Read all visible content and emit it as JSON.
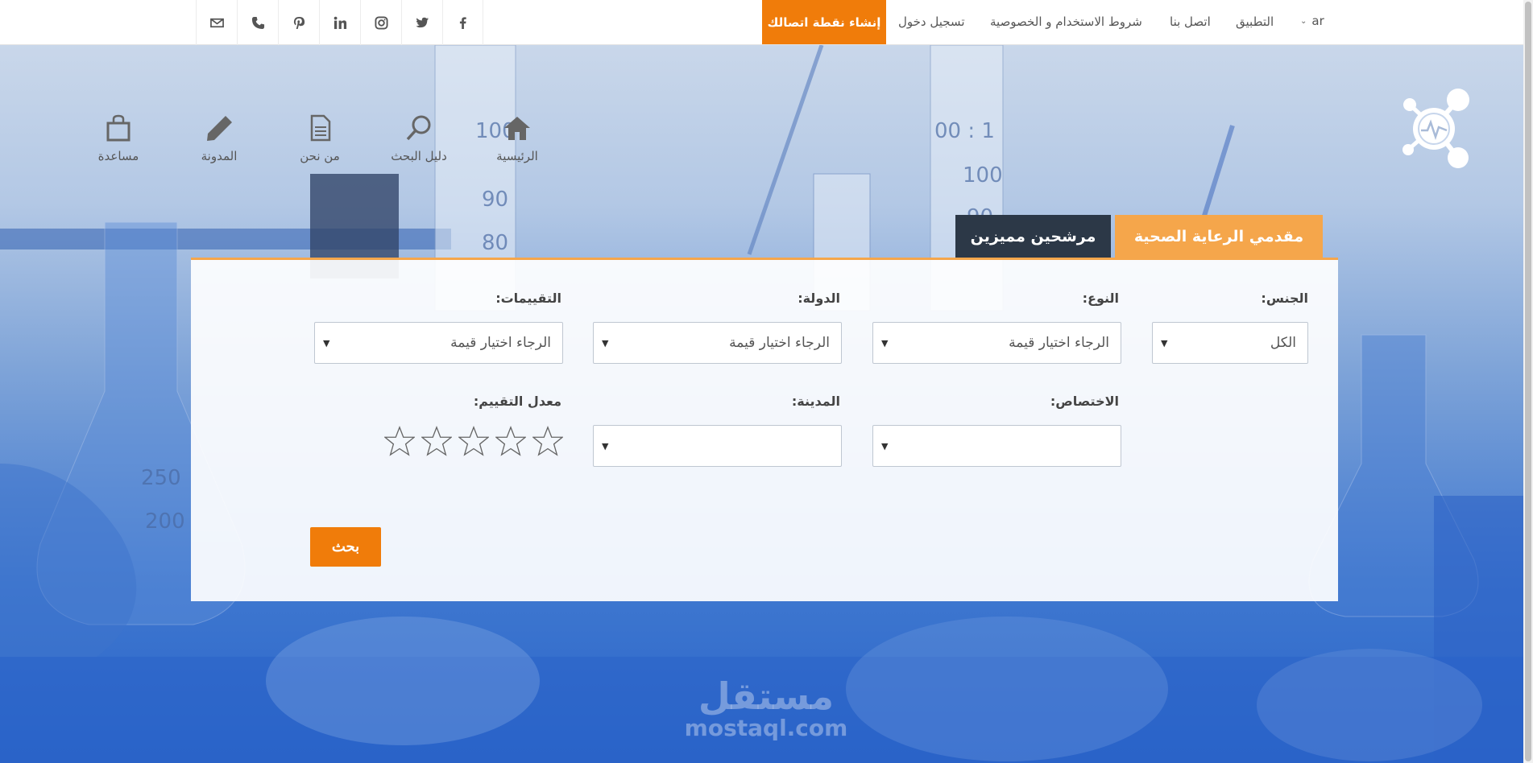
{
  "social_icons": [
    "facebook-icon",
    "twitter-icon",
    "instagram-icon",
    "linkedin-icon",
    "pinterest-icon",
    "phone-icon",
    "mail-icon"
  ],
  "topnav": {
    "cta": "إنشاء نقطة اتصالك",
    "login": "تسجيل دخول",
    "terms": "شروط الاستخدام و الخصوصية",
    "contact": "اتصل بنا",
    "app": "التطبيق",
    "lang": "ar"
  },
  "mainnav": {
    "home": "الرئيسية",
    "search_guide": "دليل البحث",
    "about": "من نحن",
    "blog": "المدونة",
    "help": "مساعدة"
  },
  "tabs": {
    "providers": "مقدمي الرعاية الصحية",
    "featured": "مرشحين مميزين"
  },
  "form": {
    "gender_label": "الجنس:",
    "gender_value": "الكل",
    "type_label": "النوع:",
    "type_value": "الرجاء اختيار قيمة",
    "country_label": "الدولة:",
    "country_value": "الرجاء اختيار قيمة",
    "ratings_label": "التقييمات:",
    "ratings_value": "الرجاء اختيار قيمة",
    "specialty_label": "الاختصاص:",
    "specialty_value": "",
    "city_label": "المدينة:",
    "city_value": "",
    "avg_rating_label": "معدل التقييم:",
    "avg_rating_value": 0,
    "avg_rating_max": 5,
    "search_button": "بحث"
  },
  "watermark": {
    "ar": "مستقل",
    "en": "mostaql.com"
  },
  "colors": {
    "accent": "#f07c0a",
    "tab_active": "#f5a64b",
    "tab_dark": "#2c3847"
  }
}
